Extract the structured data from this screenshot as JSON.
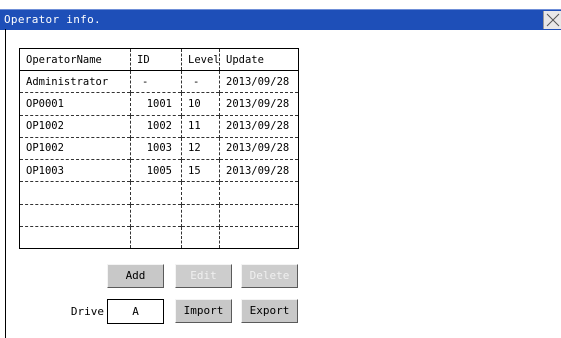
{
  "window": {
    "title": "Operator info.",
    "close_icon": "close-x-icon"
  },
  "table": {
    "columns": [
      "OperatorName",
      "ID",
      "Level",
      "Update"
    ],
    "rows": [
      {
        "name": "Administrator",
        "id": "-",
        "level": "-",
        "update": "2013/09/28"
      },
      {
        "name": "OP0001",
        "id": "1001",
        "level": "10",
        "update": "2013/09/28"
      },
      {
        "name": "OP1002",
        "id": "1002",
        "level": "11",
        "update": "2013/09/28"
      },
      {
        "name": "OP1002",
        "id": "1003",
        "level": "12",
        "update": "2013/09/28"
      },
      {
        "name": "OP1003",
        "id": "1005",
        "level": "15",
        "update": "2013/09/28"
      }
    ],
    "empty_rows": 3
  },
  "buttons": {
    "add": "Add",
    "edit": "Edit",
    "delete": "Delete",
    "import": "Import",
    "export": "Export"
  },
  "drive": {
    "label": "Drive",
    "value": "A"
  },
  "colors": {
    "titlebar": "#1e4fb8",
    "button": "#c8c8c8"
  }
}
